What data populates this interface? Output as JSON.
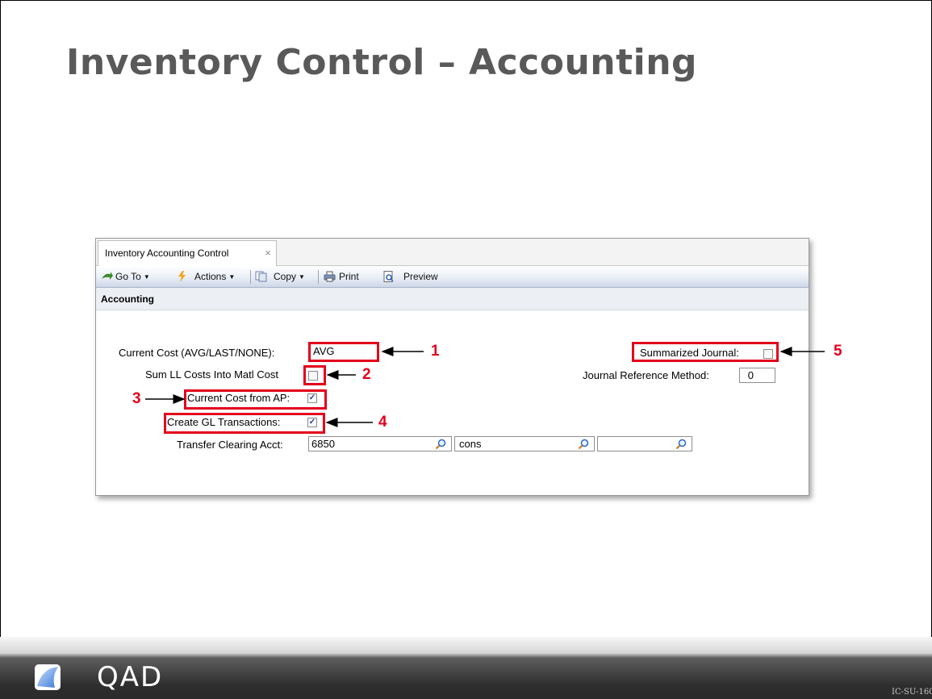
{
  "slide": {
    "title": "Inventory Control – Accounting",
    "code": "IC-SU-160",
    "brand": "QAD"
  },
  "window": {
    "tab_label": "Inventory Accounting Control",
    "tab_close_glyph": "×",
    "toolbar": {
      "goto_label": "Go To",
      "actions_label": "Actions",
      "copy_label": "Copy",
      "print_label": "Print",
      "preview_label": "Preview"
    },
    "section_title": "Accounting"
  },
  "form": {
    "current_cost_label": "Current Cost (AVG/LAST/NONE):",
    "current_cost_value": "AVG",
    "sum_ll_label": "Sum LL Costs Into Matl Cost",
    "sum_ll_checked": false,
    "current_cost_ap_label": "Current Cost from AP:",
    "current_cost_ap_checked": true,
    "create_gl_label": "Create GL Transactions:",
    "create_gl_checked": true,
    "transfer_label": "Transfer Clearing Acct:",
    "transfer_acct": "6850",
    "transfer_sub": "cons",
    "transfer_cc": "",
    "summarized_label": "Summarized Journal:",
    "summarized_checked": false,
    "journal_ref_label": "Journal Reference Method:",
    "journal_ref_value": "0"
  },
  "callouts": {
    "n1": "1",
    "n2": "2",
    "n3": "3",
    "n4": "4",
    "n5": "5",
    "color": "#e3001b"
  },
  "icons": {
    "goto": "green-arrow-icon",
    "actions": "lightning-icon",
    "copy": "copy-icon",
    "print": "printer-icon",
    "preview": "preview-icon",
    "lookup": "magnifier-icon",
    "brand": "qad-logo-icon"
  }
}
